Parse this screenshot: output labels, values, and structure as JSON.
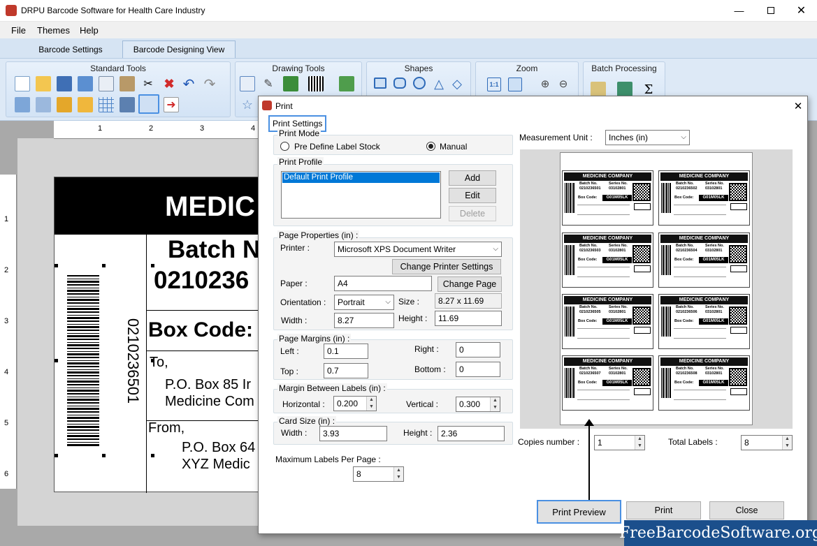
{
  "app": {
    "title": "DRPU Barcode Software for Health Care Industry",
    "menu": [
      "File",
      "Themes",
      "Help"
    ],
    "tabs": [
      "Barcode Settings",
      "Barcode Designing View"
    ],
    "ribbon_groups": {
      "standard_tools": "Standard Tools",
      "drawing_tools": "Drawing Tools",
      "shapes": "Shapes",
      "zoom": "Zoom",
      "batch_processing": "Batch Processing"
    }
  },
  "ruler": {
    "h_ticks": [
      "1",
      "2",
      "3",
      "4"
    ],
    "v_ticks": [
      "1",
      "2",
      "3",
      "4",
      "5",
      "6"
    ]
  },
  "label": {
    "header": "MEDIC",
    "batch_label": "Batch N",
    "batch_value": "0210236",
    "vertical_number": "0210236501",
    "box_code": "Box Code:",
    "to": "To,",
    "to_line1": "P.O. Box 85 Ir",
    "to_line2": "Medicine Com",
    "from": "From,",
    "from_line1": "P.O. Box 64",
    "from_line2": "XYZ Medic"
  },
  "dialog": {
    "title": "Print",
    "tab": "Print Settings",
    "print_mode": {
      "legend": "Print Mode",
      "opt1": "Pre Define Label Stock",
      "opt2": "Manual",
      "selected": "Manual"
    },
    "print_profile": {
      "legend": "Print Profile",
      "items": [
        "Default Print Profile"
      ],
      "add": "Add",
      "edit": "Edit",
      "delete": "Delete"
    },
    "page_properties": {
      "legend": "Page Properties (in) :",
      "printer_label": "Printer :",
      "printer_value": "Microsoft XPS Document Writer",
      "change_printer": "Change Printer Settings",
      "paper_label": "Paper :",
      "paper_value": "A4",
      "change_page": "Change Page",
      "orientation_label": "Orientation :",
      "orientation_value": "Portrait",
      "size_label": "Size :",
      "size_value": "8.27 x 11.69",
      "width_label": "Width :",
      "width_value": "8.27",
      "height_label": "Height :",
      "height_value": "11.69"
    },
    "margins": {
      "legend": "Page Margins (in) :",
      "left_label": "Left :",
      "left_value": "0.1",
      "right_label": "Right :",
      "right_value": "0",
      "top_label": "Top :",
      "top_value": "0.7",
      "bottom_label": "Bottom :",
      "bottom_value": "0"
    },
    "between": {
      "legend": "Margin Between Labels (in) :",
      "h_label": "Horizontal :",
      "h_value": "0.200",
      "v_label": "Vertical :",
      "v_value": "0.300"
    },
    "card_size": {
      "legend": "Card Size (in) :",
      "w_label": "Width :",
      "w_value": "3.93",
      "h_label": "Height :",
      "h_value": "2.36"
    },
    "max_labels_label": "Maximum Labels Per Page :",
    "max_labels_value": "8",
    "measurement_label": "Measurement Unit :",
    "measurement_value": "Inches (in)",
    "copies_label": "Copies number :",
    "copies_value": "1",
    "total_label": "Total Labels :",
    "total_value": "8",
    "buttons": {
      "preview": "Print Preview",
      "print": "Print",
      "close": "Close"
    }
  },
  "preview_cards": [
    {
      "company": "MEDICINE COMPANY",
      "batch": "0210236501",
      "series": "03102801",
      "box": "G01M05LK"
    },
    {
      "company": "MEDICINE COMPANY",
      "batch": "0210236502",
      "series": "03102801",
      "box": "G01M05LK"
    },
    {
      "company": "MEDICINE COMPANY",
      "batch": "0210236503",
      "series": "03102801",
      "box": "G01M05LK"
    },
    {
      "company": "MEDICINE COMPANY",
      "batch": "0210236504",
      "series": "03102801",
      "box": "G01M05LK"
    },
    {
      "company": "MEDICINE COMPANY",
      "batch": "0210236505",
      "series": "03102801",
      "box": "G01M05LK"
    },
    {
      "company": "MEDICINE COMPANY",
      "batch": "0210236506",
      "series": "03102801",
      "box": "G01M05LK"
    },
    {
      "company": "MEDICINE COMPANY",
      "batch": "0210236507",
      "series": "03102801",
      "box": "G01M05LK"
    },
    {
      "company": "MEDICINE COMPANY",
      "batch": "0210236508",
      "series": "03102801",
      "box": "G01M05LK"
    }
  ],
  "card_text": {
    "batch_no": "Batch No.",
    "series_no": "Series No.",
    "box_code": "Box Code:"
  },
  "watermark": "FreeBarcodeSoftware.org",
  "colors": {
    "accent": "#4a90e2",
    "watermark_bg": "#1b4f8c",
    "ribbon": "#dde9f6"
  }
}
